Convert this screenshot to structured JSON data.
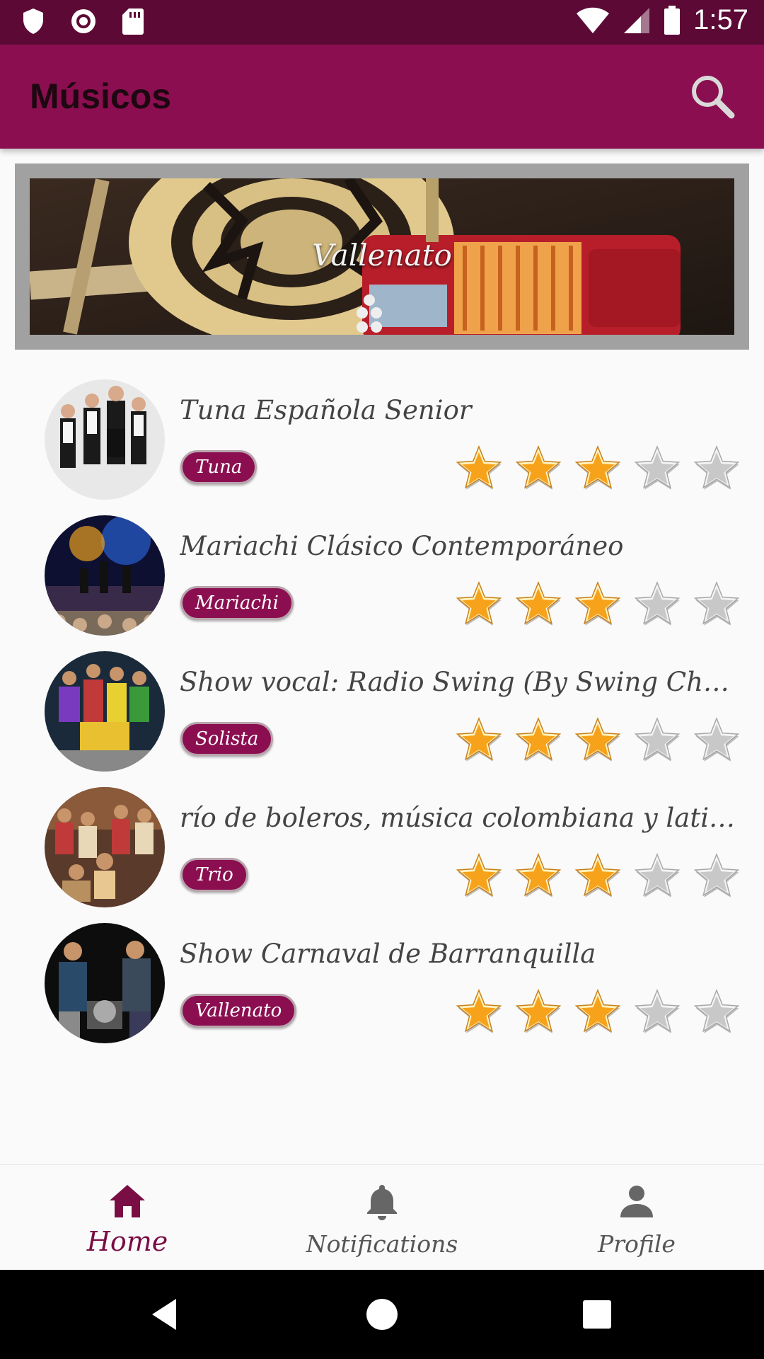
{
  "status_bar": {
    "time": "1:57",
    "icons": [
      "shield-icon",
      "record-icon",
      "sd-card-icon",
      "wifi-icon",
      "cell-signal-icon",
      "battery-icon"
    ]
  },
  "app_bar": {
    "title": "Músicos",
    "search_icon": "search-icon"
  },
  "banner": {
    "label": "Vallenato"
  },
  "musicians": [
    {
      "name": "Tuna Española Senior",
      "genre": "Tuna",
      "rating": 3,
      "max_rating": 5
    },
    {
      "name": "Mariachi Clásico Contemporáneo",
      "genre": "Mariachi",
      "rating": 3,
      "max_rating": 5
    },
    {
      "name": "Show vocal: Radio Swing (By Swing Choir)",
      "genre": "Solista",
      "rating": 3,
      "max_rating": 5
    },
    {
      "name": "río de boleros, música colombiana y lationam...",
      "genre": "Trio",
      "rating": 3,
      "max_rating": 5
    },
    {
      "name": "Show Carnaval de Barranquilla",
      "genre": "Vallenato",
      "rating": 3,
      "max_rating": 5
    }
  ],
  "bottom_nav": {
    "items": [
      {
        "label": "Home",
        "icon": "home-icon",
        "active": true
      },
      {
        "label": "Notifications",
        "icon": "bell-icon",
        "active": false
      },
      {
        "label": "Profile",
        "icon": "person-icon",
        "active": false
      }
    ]
  },
  "colors": {
    "primary": "#8b0f50",
    "primary_dark": "#5c0a35",
    "star_filled": "#f7a21b",
    "star_empty": "#c8c8c8"
  }
}
